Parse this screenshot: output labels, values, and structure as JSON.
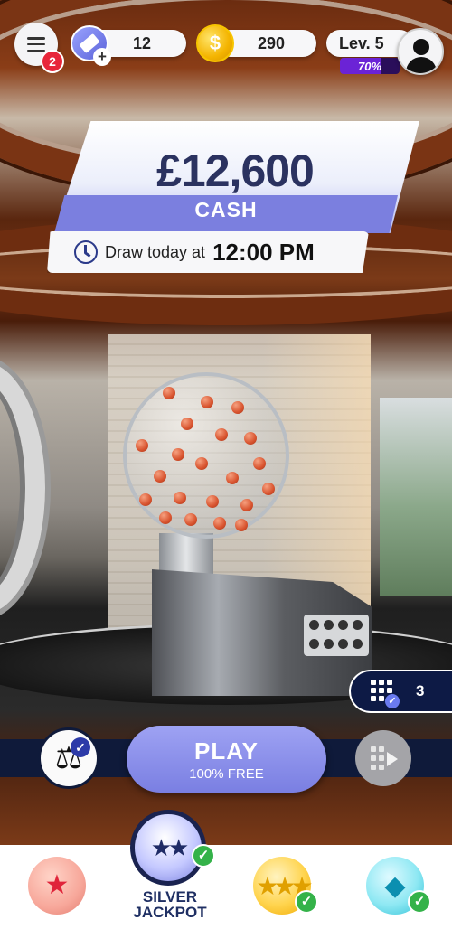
{
  "header": {
    "menu_badge": "2",
    "tickets": "12",
    "coins": "290",
    "level": "Lev. 5",
    "level_progress": "70%",
    "level_progress_fraction": 0.7,
    "coin_symbol": "$"
  },
  "jackpot": {
    "amount": "£12,600",
    "type": "CASH",
    "draw_label": "Draw today at",
    "draw_time": "12:00 PM"
  },
  "ticket_counter": {
    "count": "3"
  },
  "play": {
    "label": "PLAY",
    "sub": "100% FREE"
  },
  "bottom_nav": {
    "active_label_line1": "SILVER",
    "active_label_line2": "JACKPOT",
    "items": [
      "ruby-jackpot",
      "silver-jackpot",
      "gold-jackpot",
      "diamond-jackpot"
    ]
  },
  "colors": {
    "accent": "#7b7fdf",
    "navy": "#0f1a3a",
    "check_green": "#34b249",
    "badge_red": "#e8263a",
    "level_purple": "#6b23d6"
  }
}
